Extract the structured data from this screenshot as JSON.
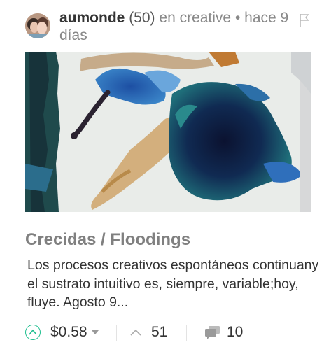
{
  "post": {
    "author": "aumonde",
    "reputation": "(50)",
    "category_text": "en creative",
    "dot": "•",
    "time_text": "hace 9 días",
    "title": "Crecidas / Floodings",
    "body": "Los procesos creativos espontáneos continuany el sustrato intuitivo es, siempre, variable;hoy, fluye. Agosto 9...",
    "image_icon": "ink-painting-image"
  },
  "footer": {
    "payout": "$0.58",
    "votes": "51",
    "comments": "10",
    "icons": [
      "upvote-icon",
      "dropdown-icon",
      "vote-count-icon",
      "comment-icon"
    ]
  },
  "colors": {
    "accent": "#1fbf8f",
    "muted": "#888888",
    "title": "#808080"
  }
}
